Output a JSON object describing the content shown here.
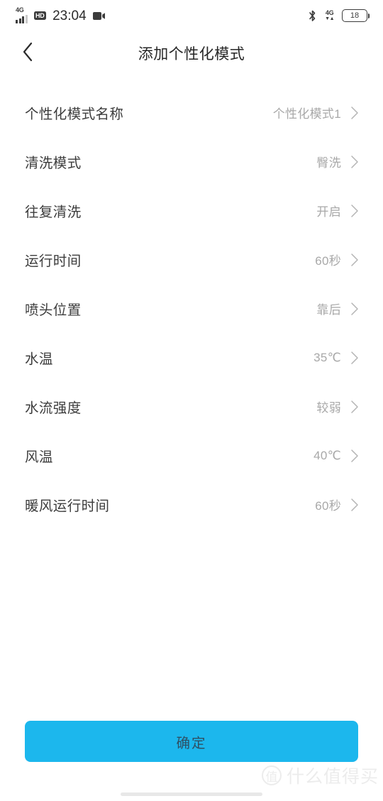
{
  "status_bar": {
    "network_type": "4G",
    "hd_badge": "HD",
    "time": "23:04",
    "camera_icon": "video-camera-icon",
    "bluetooth_icon": "bluetooth-icon",
    "data_network_type": "4G",
    "data_arrows": "▼▲",
    "battery_level": "18"
  },
  "header": {
    "back_icon": "chevron-left-icon",
    "title": "添加个性化模式"
  },
  "settings": {
    "items": [
      {
        "label": "个性化模式名称",
        "value": "个性化模式1",
        "chevron": "chevron-right-icon"
      },
      {
        "label": "清洗模式",
        "value": "臀洗",
        "chevron": "chevron-right-icon"
      },
      {
        "label": "往复清洗",
        "value": "开启",
        "chevron": "chevron-right-icon"
      },
      {
        "label": "运行时间",
        "value": "60秒",
        "chevron": "chevron-right-icon"
      },
      {
        "label": "喷头位置",
        "value": "靠后",
        "chevron": "chevron-right-icon"
      },
      {
        "label": "水温",
        "value": "35℃",
        "chevron": "chevron-right-icon"
      },
      {
        "label": "水流强度",
        "value": "较弱",
        "chevron": "chevron-right-icon"
      },
      {
        "label": "风温",
        "value": "40℃",
        "chevron": "chevron-right-icon"
      },
      {
        "label": "暖风运行时间",
        "value": "60秒",
        "chevron": "chevron-right-icon"
      }
    ]
  },
  "footer": {
    "confirm_label": "确定"
  },
  "watermark": {
    "logo_text": "值",
    "text": "什么值得买"
  },
  "colors": {
    "accent": "#1cb7ed",
    "label_text": "#3c3c3c",
    "value_text": "#a8a8a8",
    "title_text": "#262626",
    "watermark": "#ececec"
  }
}
